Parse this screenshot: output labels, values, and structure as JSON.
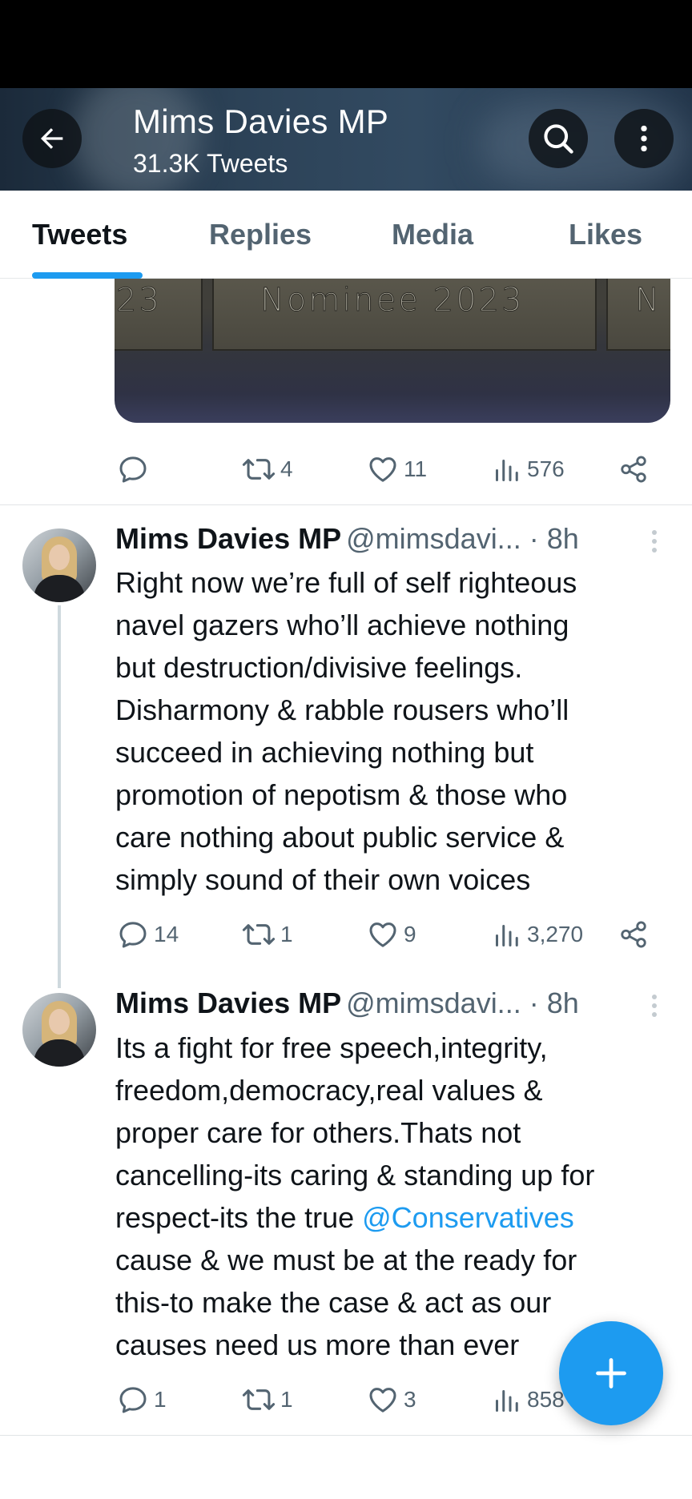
{
  "header": {
    "title": "Mims Davies MP",
    "subtitle": "31.3K Tweets"
  },
  "tabs": [
    {
      "label": "Tweets",
      "active": true
    },
    {
      "label": "Replies",
      "active": false
    },
    {
      "label": "Media",
      "active": false
    },
    {
      "label": "Likes",
      "active": false
    }
  ],
  "media": {
    "plaque_left": "23",
    "plaque_mid": "Nominee 2023",
    "plaque_right": "N"
  },
  "tweets": [
    {
      "replies": "",
      "retweets": "4",
      "likes": "11",
      "views": "576"
    },
    {
      "name": "Mims Davies MP",
      "handle": "@mimsdavi...",
      "time": "· 8h",
      "text": "Right now we’re full of self righteous\nnavel gazers who’ll achieve nothing\nbut destruction/divisive feelings.\nDisharmony & rabble rousers who’ll\nsucceed in achieving nothing but\npromotion of nepotism & those who\ncare nothing about public service &\nsimply sound of their own voices",
      "replies": "14",
      "retweets": "1",
      "likes": "9",
      "views": "3,270"
    },
    {
      "name": "Mims Davies MP",
      "handle": "@mimsdavi...",
      "time": "· 8h",
      "text_before": "Its a fight for free speech,integrity,\nfreedom,democracy,real values &\nproper care for others.Thats not\ncancelling-its caring & standing up for\nrespect-its the true ",
      "mention": "@Conservatives",
      "text_after": "\ncause & we must be at the ready for\nthis-to make the case & act as our\ncauses need us more than ever",
      "replies": "1",
      "retweets": "1",
      "likes": "3",
      "views": "858"
    }
  ],
  "icons": {
    "back": "arrow-left-icon",
    "search": "search-icon",
    "more": "more-vertical-icon",
    "reply": "reply-icon",
    "retweet": "retweet-icon",
    "like": "heart-icon",
    "views": "views-icon",
    "share": "share-icon",
    "compose": "plus-icon"
  },
  "colors": {
    "accent": "#1d9bf0",
    "secondary_text": "#536471"
  }
}
